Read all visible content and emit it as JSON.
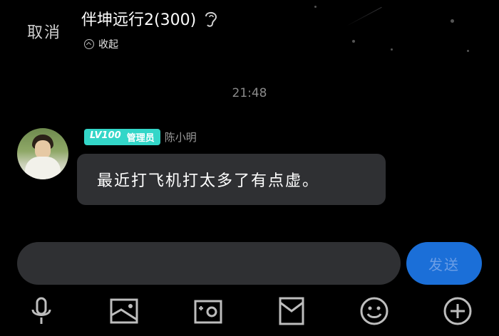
{
  "header": {
    "cancel_label": "取消",
    "group_title": "伴坤远行2(300)",
    "collapse_label": "收起"
  },
  "chat": {
    "timestamp": "21:48",
    "messages": [
      {
        "badge_level": "LV100",
        "badge_role": "管理员",
        "sender": "陈小明",
        "text": "最近打飞机打太多了有点虚。"
      }
    ]
  },
  "composer": {
    "input_value": "",
    "send_label": "发送"
  },
  "toolbar": {
    "icons": [
      "microphone-icon",
      "image-icon",
      "camera-icon",
      "red-packet-icon",
      "emoji-icon",
      "plus-icon"
    ]
  },
  "colors": {
    "background": "#000000",
    "bubble": "#2f3033",
    "badge": "#33d6c8",
    "send_button": "#1b6fd8",
    "send_text": "#6b9ee6"
  }
}
